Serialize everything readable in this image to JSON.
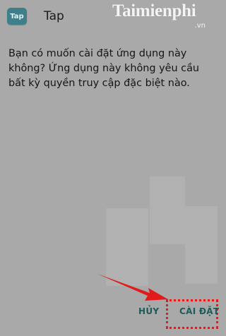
{
  "app": {
    "icon_text": "Tap",
    "title": "Tap"
  },
  "watermark": {
    "main": "Taimienphi",
    "tld": ".vn"
  },
  "dialog": {
    "message": "Bạn có muốn cài đặt ứng dụng này không? Ứng dụng này không yêu cầu bất kỳ quyền truy cập đặc biệt nào."
  },
  "actions": {
    "cancel_label": "HỦY",
    "install_label": "CÀI ĐẶT"
  },
  "colors": {
    "background": "#a9a9a9",
    "icon_bg": "#3f7f8c",
    "button_text": "#1e5a57",
    "highlight": "#e11b1b",
    "arrow": "#e11b1b"
  }
}
